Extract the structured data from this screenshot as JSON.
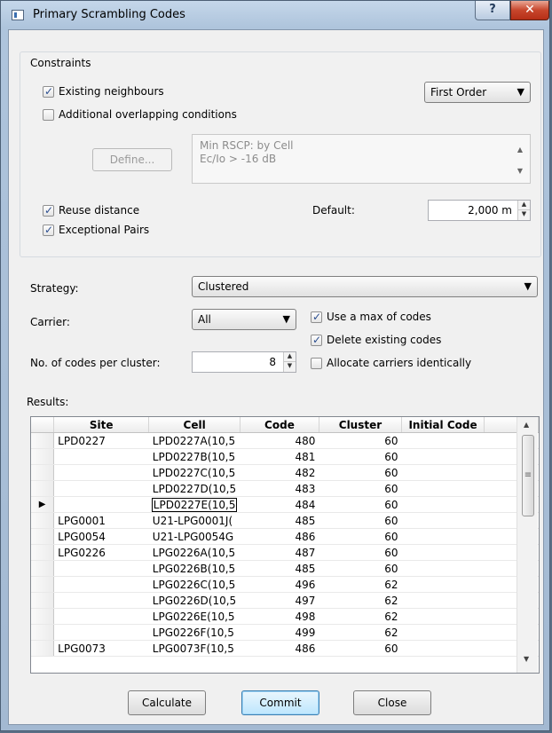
{
  "window": {
    "title": "Primary Scrambling Codes",
    "help_glyph": "?",
    "close_glyph": "✕"
  },
  "constraints": {
    "label": "Constraints",
    "existing_neighbours": {
      "label": "Existing neighbours",
      "checked": true
    },
    "neighbour_order": "First Order",
    "additional_overlapping": {
      "label": "Additional overlapping conditions",
      "checked": false
    },
    "define_label": "Define...",
    "conditions_lines": [
      "Min RSCP: by Cell",
      "Ec/Io > -16 dB"
    ],
    "reuse_distance": {
      "label": "Reuse distance",
      "checked": true
    },
    "exceptional_pairs": {
      "label": "Exceptional Pairs",
      "checked": true
    },
    "default_label": "Default:",
    "default_value": "2,000  m"
  },
  "strategy": {
    "label": "Strategy:",
    "value": "Clustered"
  },
  "carrier": {
    "label": "Carrier:",
    "value": "All"
  },
  "codes_per_cluster": {
    "label": "No. of codes per cluster:",
    "value": "8"
  },
  "options": {
    "use_max_codes": {
      "label": "Use a max of codes",
      "checked": true
    },
    "delete_existing": {
      "label": "Delete existing codes",
      "checked": true
    },
    "allocate_identically": {
      "label": "Allocate carriers identically",
      "checked": false
    }
  },
  "results": {
    "label": "Results:",
    "columns": [
      "Site",
      "Cell",
      "Code",
      "Cluster",
      "Initial Code"
    ],
    "current_row": 4,
    "rows": [
      {
        "site": "LPD0227",
        "cell": "LPD0227A(10,5",
        "code": "480",
        "cluster": "60",
        "initial": ""
      },
      {
        "site": "",
        "cell": "LPD0227B(10,5",
        "code": "481",
        "cluster": "60",
        "initial": ""
      },
      {
        "site": "",
        "cell": "LPD0227C(10,5",
        "code": "482",
        "cluster": "60",
        "initial": ""
      },
      {
        "site": "",
        "cell": "LPD0227D(10,5",
        "code": "483",
        "cluster": "60",
        "initial": ""
      },
      {
        "site": "",
        "cell": "LPD0227E(10,5",
        "code": "484",
        "cluster": "60",
        "initial": ""
      },
      {
        "site": "LPG0001",
        "cell": "U21-LPG0001J(",
        "code": "485",
        "cluster": "60",
        "initial": ""
      },
      {
        "site": "LPG0054",
        "cell": "U21-LPG0054G",
        "code": "486",
        "cluster": "60",
        "initial": ""
      },
      {
        "site": "LPG0226",
        "cell": "LPG0226A(10,5",
        "code": "487",
        "cluster": "60",
        "initial": ""
      },
      {
        "site": "",
        "cell": "LPG0226B(10,5",
        "code": "485",
        "cluster": "60",
        "initial": ""
      },
      {
        "site": "",
        "cell": "LPG0226C(10,5",
        "code": "496",
        "cluster": "62",
        "initial": ""
      },
      {
        "site": "",
        "cell": "LPG0226D(10,5",
        "code": "497",
        "cluster": "62",
        "initial": ""
      },
      {
        "site": "",
        "cell": "LPG0226E(10,5",
        "code": "498",
        "cluster": "62",
        "initial": ""
      },
      {
        "site": "",
        "cell": "LPG0226F(10,5",
        "code": "499",
        "cluster": "62",
        "initial": ""
      },
      {
        "site": "LPG0073",
        "cell": "LPG0073F(10,5",
        "code": "486",
        "cluster": "60",
        "initial": ""
      }
    ]
  },
  "buttons": {
    "calculate": "Calculate",
    "commit": "Commit",
    "close": "Close"
  },
  "glyphs": {
    "dropdown": "▼",
    "spin_up": "▲",
    "spin_down": "▼",
    "row_pointer": "▶",
    "scroll_up": "▲",
    "scroll_down": "▼",
    "thumb_grip": "≡"
  }
}
